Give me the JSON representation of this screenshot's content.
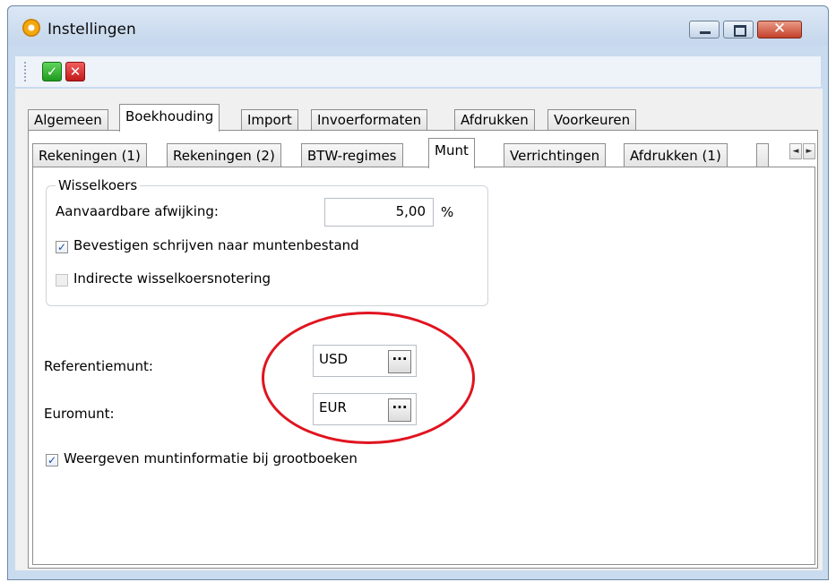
{
  "window": {
    "title": "Instellingen"
  },
  "window_buttons": {
    "close_glyph": "✕"
  },
  "toolbar": {
    "ok_glyph": "✓",
    "cancel_glyph": "✕"
  },
  "main_tabs": [
    "Algemeen",
    "Boekhouding",
    "Import",
    "Invoerformaten",
    "Afdrukken",
    "Voorkeuren"
  ],
  "sub_tabs": [
    "Rekeningen (1)",
    "Rekeningen (2)",
    "BTW-regimes",
    "Munt",
    "Verrichtingen",
    "Afdrukken (1)"
  ],
  "scroll": {
    "left": "◄",
    "right": "►"
  },
  "wisselkoers": {
    "legend": "Wisselkoers",
    "afwijking_label": "Aanvaardbare afwijking:",
    "afwijking_value": "5,00",
    "afwijking_unit": "%",
    "bevestigen_label": "Bevestigen schrijven naar muntenbestand",
    "bevestigen_checked": true,
    "indirecte_label": "Indirecte wisselkoersnotering",
    "indirecte_checked": false
  },
  "referentiemunt": {
    "label": "Referentiemunt:",
    "value": "USD",
    "button": "···"
  },
  "euromunt": {
    "label": "Euromunt:",
    "value": "EUR",
    "button": "···"
  },
  "weergeven": {
    "label": "Weergeven muntinformatie bij grootboeken",
    "checked": true
  },
  "check_glyph": "✓",
  "colors": {
    "highlight": "#e0141f",
    "window_frame": "#c9dbee"
  }
}
